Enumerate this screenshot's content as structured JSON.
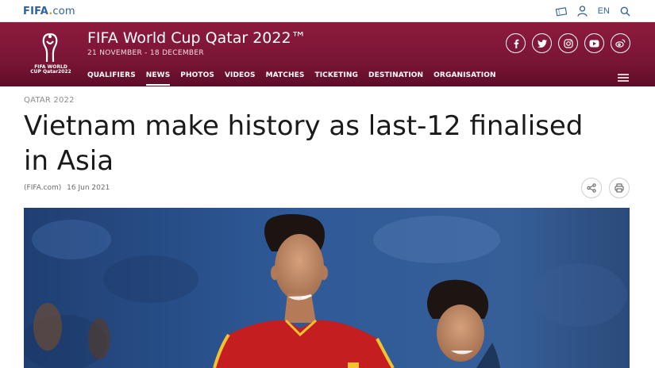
{
  "topbar": {
    "logo": {
      "main": "FIFA",
      "dot": ".",
      "suffix": "com"
    },
    "language": "EN",
    "icons": [
      "ticket-icon",
      "user-icon",
      "search-icon"
    ]
  },
  "header": {
    "emblem_text": "FIFA WORLD CUP Qatar2022",
    "title": "FIFA World Cup Qatar 2022™",
    "dates": "21 NOVEMBER - 18 DECEMBER",
    "nav": [
      {
        "label": "QUALIFIERS",
        "active": false
      },
      {
        "label": "NEWS",
        "active": true
      },
      {
        "label": "PHOTOS",
        "active": false
      },
      {
        "label": "VIDEOS",
        "active": false
      },
      {
        "label": "MATCHES",
        "active": false
      },
      {
        "label": "TICKETING",
        "active": false
      },
      {
        "label": "DESTINATION",
        "active": false
      },
      {
        "label": "ORGANISATION",
        "active": false
      }
    ],
    "social": [
      "facebook-icon",
      "twitter-icon",
      "instagram-icon",
      "youtube-icon",
      "weibo-icon"
    ],
    "colors": {
      "primary": "#8d1b3d",
      "dark": "#5e0d28"
    }
  },
  "article": {
    "section": "QATAR 2022",
    "headline": "Vietnam make history as last-12 finalised in Asia",
    "source": "(FIFA.com)",
    "date": "16 Jun 2021",
    "actions": [
      "share-icon",
      "print-icon"
    ]
  },
  "hero": {
    "description_icon": "photo-image"
  }
}
